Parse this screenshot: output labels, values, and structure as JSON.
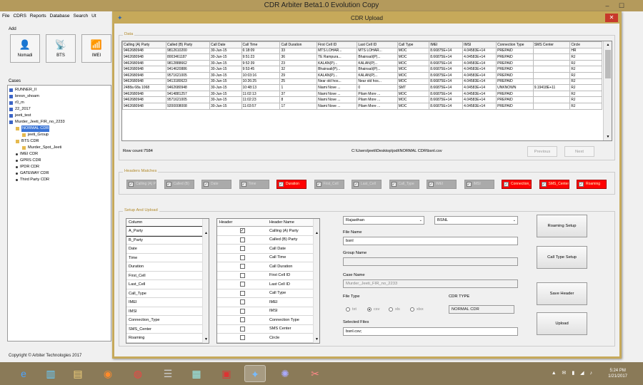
{
  "app": {
    "title": "CDR Arbiter Beta1.0 Evolution Copy"
  },
  "menu": [
    "File",
    "CDRS",
    "Reports",
    "Database",
    "Search",
    "Ut"
  ],
  "add": {
    "label": "Add",
    "buttons": [
      {
        "label": "Nomadi",
        "icon": "👤"
      },
      {
        "label": "BTS",
        "icon": "📡"
      },
      {
        "label": "IMEI",
        "icon": "📶"
      }
    ]
  },
  "cases": {
    "label": "Cases",
    "items": [
      {
        "text": "RUNNER_II",
        "lvl": 0,
        "t": "n"
      },
      {
        "text": "bresn_shoam",
        "lvl": 0,
        "t": "n"
      },
      {
        "text": "r0_m",
        "lvl": 0,
        "t": "n"
      },
      {
        "text": "22_2017",
        "lvl": 0,
        "t": "n"
      },
      {
        "text": "jeeti_test",
        "lvl": 0,
        "t": "n"
      },
      {
        "text": "Murder_Jeeti_FIR_no_2233",
        "lvl": 0,
        "t": "n"
      },
      {
        "text": "NORMAL CDR",
        "lvl": 1,
        "t": "f",
        "sel": true
      },
      {
        "text": "jeeti_Group",
        "lvl": 2,
        "t": "f"
      },
      {
        "text": "BTS CDR",
        "lvl": 1,
        "t": "f"
      },
      {
        "text": "Murder_Spot_Jeeti",
        "lvl": 2,
        "t": "f"
      },
      {
        "text": "IMEI CDR",
        "lvl": 1,
        "t": "b"
      },
      {
        "text": "GPRS CDR",
        "lvl": 1,
        "t": "b"
      },
      {
        "text": "IPDR CDR",
        "lvl": 1,
        "t": "b"
      },
      {
        "text": "GATEWAY CDR",
        "lvl": 1,
        "t": "b"
      },
      {
        "text": "Third Party CDR",
        "lvl": 1,
        "t": "b"
      }
    ]
  },
  "copyright": "Copyright © Arbiter Technologies 2017",
  "dialog": {
    "title": "CDR Upload",
    "data_legend": "Data",
    "grid": {
      "columns": [
        "Calling (A) Party",
        "Called (B) Party",
        "Call Date",
        "Call Time",
        "Call Duration",
        "First Cell ID",
        "Last Cell ID",
        "Call Type",
        "IMEI",
        "IMSI",
        "Connection Type",
        "SMS Center",
        "Circle"
      ],
      "rows": [
        [
          "9462680948",
          "9812610200",
          "30-Jun-15",
          "6:18:09",
          "33",
          "MTS LOHAR...",
          "MTS LOHAR...",
          "MOC",
          "8.66875E+14",
          "4.04583E+14",
          "PREPAID",
          "",
          "HR"
        ],
        [
          "9462680948",
          "8003461187",
          "30-Jun-15",
          "9:51:23",
          "36",
          "TE Rampura...",
          "Bhainsali(P)...",
          "MOC",
          "8.66875E+14",
          "4.04583E+14",
          "PREPAID",
          "",
          "RJ"
        ],
        [
          "9462680948",
          "9812888662",
          "30-Jun-15",
          "9:52:39",
          "23",
          "KALAN(P)...",
          "KALAN(P)...",
          "MOC",
          "8.66875E+14",
          "4.04583E+14",
          "PREPAID",
          "",
          "RJ"
        ],
        [
          "9462680948",
          "9414620886",
          "30-Jun-15",
          "9:53:45",
          "32",
          "Bhainsali(P)...",
          "Bhainsali(P)...",
          "MOC",
          "8.66875E+14",
          "4.04583E+14",
          "PREPAID",
          "",
          "RJ"
        ],
        [
          "9462680948",
          "9571621005",
          "30-Jun-15",
          "10:03:16",
          "29",
          "KALAN(P)...",
          "KALAN(P)...",
          "MOC",
          "8.66875E+14",
          "4.04583E+14",
          "PREPAID",
          "",
          "RJ"
        ],
        [
          "9462680948",
          "9413180623",
          "30-Jun-15",
          "10:26:25",
          "25",
          "Near old hos...",
          "Near old hos...",
          "MOC",
          "8.66875E+14",
          "4.04583E+14",
          "PREPAID",
          "",
          "RJ"
        ],
        [
          "2488a 68a 1068",
          "9462680948",
          "30-Jun-15",
          "10:48:13",
          "1",
          "Niami Nove ...",
          "0",
          "SMT",
          "8.66875E+14",
          "4.04583E+14",
          "UNKNOWN",
          "9.19418E+11",
          "RJ"
        ],
        [
          "9462680948",
          "9414881257",
          "30-Jun-15",
          "11:02:13",
          "37",
          "Niami Nove ...",
          "Pilam More ...",
          "MOC",
          "8.66875E+14",
          "4.04583E+14",
          "PREPAID",
          "",
          "RJ"
        ],
        [
          "9462680948",
          "9571621005",
          "30-Jun-15",
          "11:02:23",
          "8",
          "Niami Nove ...",
          "Pilam More ...",
          "MOC",
          "8.66875E+14",
          "4.04583E+14",
          "PREPAID",
          "",
          "RJ"
        ],
        [
          "9462680948",
          "9200008008",
          "30-Jun-15",
          "11:03:57",
          "17",
          "Niami Nove ...",
          "Pilam More ...",
          "MOC",
          "8.66875E+14",
          "4.04583E+14",
          "PREPAID",
          "",
          "RJ"
        ]
      ]
    },
    "row_count": "Row count:7584",
    "file_path": "C:\\Users\\jeeti\\Desktop\\jodi\\NORMAL CDR\\bsnl.csv",
    "previous": "Previous",
    "next": "Next",
    "headers_legend": "Headers Matches",
    "headers": [
      {
        "label": "Calling (A) Party",
        "ok": true
      },
      {
        "label": "Called (B)",
        "ok": true
      },
      {
        "label": "Date",
        "ok": true
      },
      {
        "label": "Time",
        "ok": true
      },
      {
        "label": "Duration",
        "ok": false
      },
      {
        "label": "First_Cell",
        "ok": true
      },
      {
        "label": "Last_Cell",
        "ok": true
      },
      {
        "label": "Call_Type",
        "ok": true
      },
      {
        "label": "IMEI",
        "ok": true
      },
      {
        "label": "IMSI",
        "ok": true
      },
      {
        "label": "Connection_Type",
        "ok": false
      },
      {
        "label": "SMS_Center",
        "ok": false
      },
      {
        "label": "Roaming",
        "ok": false
      }
    ],
    "setup_legend": "Setup And Upload",
    "columns_header": "Column",
    "columns": [
      "A_Party",
      "B_Party",
      "Date",
      "Time",
      "Duration",
      "First_Cell",
      "Last_Cell",
      "Call_Type",
      "IMEI",
      "IMSI",
      "Connection_Type",
      "SMS_Center",
      "Roaming"
    ],
    "header_col": "Header",
    "header_name_col": "Header Name",
    "header_names": [
      {
        "name": "Calling (A) Party",
        "checked": true
      },
      {
        "name": "Called (B) Party",
        "checked": false
      },
      {
        "name": "Call Date",
        "checked": false
      },
      {
        "name": "Call Time",
        "checked": false
      },
      {
        "name": "Call Duration",
        "checked": false
      },
      {
        "name": "First Cell ID",
        "checked": false
      },
      {
        "name": "Last Cell ID",
        "checked": false
      },
      {
        "name": "Call Type",
        "checked": false
      },
      {
        "name": "IMEI",
        "checked": false
      },
      {
        "name": "IMSI",
        "checked": false
      },
      {
        "name": "Connection Type",
        "checked": false
      },
      {
        "name": "SMS Center",
        "checked": false
      },
      {
        "name": "Circle",
        "checked": false
      }
    ],
    "state": "Rajasthan",
    "operator": "BSNL",
    "file_name_label": "File Name",
    "file_name": "bsnl",
    "group_name_label": "Group Name",
    "group_name": "",
    "case_name_label": "Case Name",
    "case_name": "Murder_Jeeti_FIR_no_2233",
    "file_type_label": "File Type",
    "file_types": [
      {
        "label": "txt",
        "on": false
      },
      {
        "label": "csv",
        "on": true
      },
      {
        "label": "xls",
        "on": false
      },
      {
        "label": "xlsx",
        "on": false
      }
    ],
    "cdr_type_label": "CDR TYPE",
    "cdr_type": "NORMAL CDR",
    "selected_files_label": "Selected Files",
    "selected_files": "bsnl.csv;",
    "buttons": [
      "Roaming Setup",
      "Call Type Setup",
      "Save Header",
      "Upload"
    ]
  },
  "taskbar": {
    "clock_time": "5:24 PM",
    "clock_date": "1/21/2017"
  }
}
